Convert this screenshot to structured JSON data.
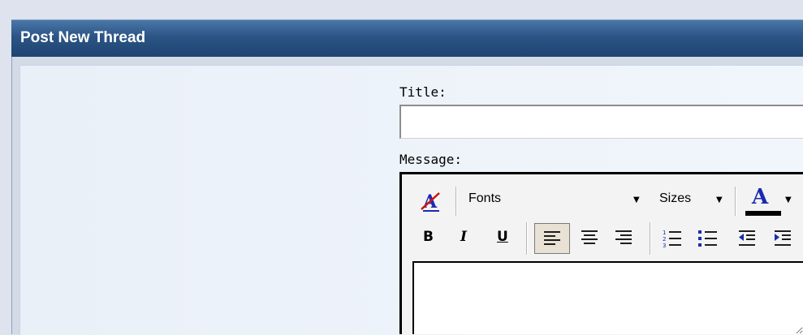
{
  "header": {
    "title": "Post New Thread"
  },
  "form": {
    "title_label": "Title:",
    "title_value": "",
    "message_label": "Message:"
  },
  "toolbar": {
    "fonts_label": "Fonts",
    "sizes_label": "Sizes",
    "bold": "B",
    "italic": "I",
    "underline": "U",
    "font_color_label": "A",
    "active_alignment": "align-left"
  },
  "editor": {
    "content": ""
  },
  "colors": {
    "header_bar": "#2c5585",
    "panel_background": "#eef3f9",
    "active_tool": "#e9e1d4"
  }
}
